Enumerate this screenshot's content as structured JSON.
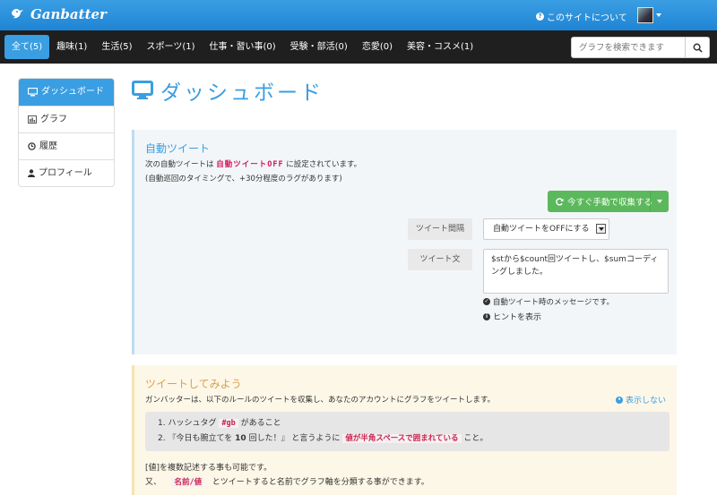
{
  "header": {
    "brand": "Ganbatter",
    "about_link": "このサイトについて"
  },
  "categories": [
    {
      "label": "全て(5)",
      "active": true
    },
    {
      "label": "趣味(1)"
    },
    {
      "label": "生活(5)"
    },
    {
      "label": "スポーツ(1)"
    },
    {
      "label": "仕事・習い事(0)"
    },
    {
      "label": "受験・部活(0)"
    },
    {
      "label": "恋愛(0)"
    },
    {
      "label": "美容・コスメ(1)"
    }
  ],
  "search": {
    "placeholder": "グラフを検索できます"
  },
  "sidebar": {
    "items": [
      {
        "label": "ダッシュボード",
        "icon": "monitor-icon",
        "active": true
      },
      {
        "label": "グラフ",
        "icon": "chart-icon"
      },
      {
        "label": "履歴",
        "icon": "clock-icon"
      },
      {
        "label": "プロフィール",
        "icon": "user-icon"
      }
    ]
  },
  "page": {
    "title": "ダッシュボード"
  },
  "auto_tweet": {
    "title": "自動ツイート",
    "line1_pre": "次の自動ツイートは",
    "line1_kw": "自動ツイートOFF",
    "line1_post": "に設定されています。",
    "line2": "(自動巡回のタイミングで、+30分程度のラグがあります)",
    "collect_button": "今すぐ手動で収集する",
    "interval_label": "ツイート間隔",
    "interval_value": "自動ツイートをOFFにする",
    "text_label": "ツイート文",
    "text_value": "$stから$count回ツイートし、$sumコーディングしました。",
    "hint_message": "自動ツイート時のメッセージです。",
    "hint_toggle": "ヒントを表示"
  },
  "try_tweet": {
    "title": "ツイートしてみよう",
    "desc": "ガンバッターは、以下のルールのツイートを収集し、あなたのアカウントにグラフをツイートします。",
    "hide_link": "表示しない",
    "rule1_pre": "1.  ハッシュタグ",
    "rule1_code": "#gb",
    "rule1_post": "があること",
    "rule2_pre": "2.  『今日も腕立てを",
    "rule2_num": "10",
    "rule2_mid": "回した！』 と言うように",
    "rule2_code": "値が半角スペースで囲まれている",
    "rule2_post": "こと。",
    "foot1": "[値]を複数記述する事も可能です。",
    "foot2_pre": "又、",
    "foot2_code": "名前/値",
    "foot2_post": "とツイートすると名前でグラフ軸を分類する事ができます。"
  },
  "colors": {
    "accent": "#3a9ee3",
    "nav_bg": "#1f1f1f",
    "success": "#5cb85c",
    "keyword": "#d3145a"
  }
}
